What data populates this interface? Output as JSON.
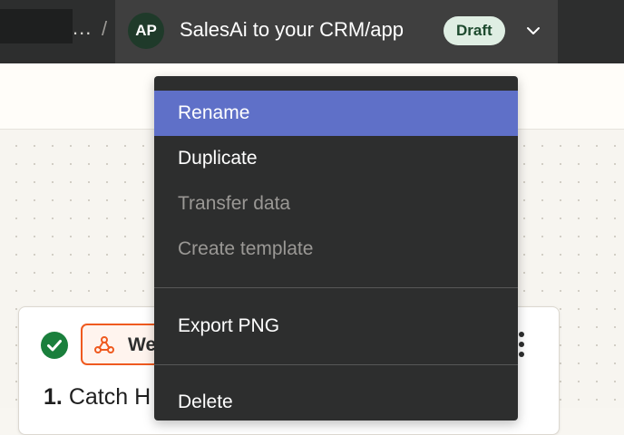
{
  "header": {
    "ellipsis": "...",
    "separator": "/",
    "avatar_initials": "AP",
    "zap_title": "SalesAi to your CRM/app",
    "status_badge": "Draft"
  },
  "menu": {
    "items": [
      {
        "label": "Rename",
        "state": "highlighted"
      },
      {
        "label": "Duplicate",
        "state": "enabled"
      },
      {
        "label": "Transfer data",
        "state": "disabled"
      },
      {
        "label": "Create template",
        "state": "disabled"
      },
      {
        "label": "Export PNG",
        "state": "enabled"
      },
      {
        "label": "Delete",
        "state": "enabled"
      }
    ]
  },
  "step": {
    "app_label": "We",
    "number": "1.",
    "title": "Catch H",
    "status_icon": "check-circle-icon",
    "app_icon": "webhook-icon"
  },
  "colors": {
    "topbar": "#2d2e2e",
    "menu_background": "#2d2e2e",
    "menu_highlight": "#5f70c8",
    "draft_badge": "#dfeee3",
    "success_green": "#1a7f3c",
    "webhook_orange": "#ef5a1f"
  }
}
